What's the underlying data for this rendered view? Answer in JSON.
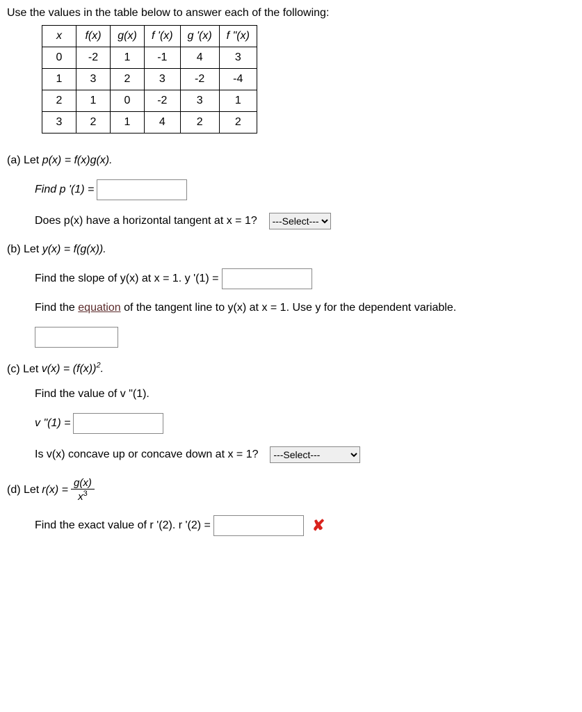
{
  "intro": "Use the values in the table below to answer each of the following:",
  "table": {
    "headers": [
      "x",
      "f(x)",
      "g(x)",
      "f '(x)",
      "g '(x)",
      "f \"(x)"
    ],
    "rows": [
      [
        "0",
        "-2",
        "1",
        "-1",
        "4",
        "3"
      ],
      [
        "1",
        "3",
        "2",
        "3",
        "-2",
        "-4"
      ],
      [
        "2",
        "1",
        "0",
        "-2",
        "3",
        "1"
      ],
      [
        "3",
        "2",
        "1",
        "4",
        "2",
        "2"
      ]
    ]
  },
  "partA": {
    "label": "(a) Let ",
    "def": "p(x) = f(x)g(x).",
    "find": "Find p '(1) = ",
    "tangent_q": "Does p(x) have a horizontal tangent at x = 1?",
    "select_placeholder": "---Select---"
  },
  "partB": {
    "label": "(b) Let ",
    "def": "y(x) = f(g(x)).",
    "slope": "Find the slope of y(x) at x = 1. y '(1) = ",
    "tangent_line_pre": "Find the ",
    "tangent_line_link": "equation",
    "tangent_line_post": " of the tangent line to y(x) at x = 1. Use y for the dependent variable."
  },
  "partC": {
    "label": "(c) Let ",
    "def_pre": "v(x) = (f(x))",
    "def_sup": "2",
    "def_post": ".",
    "find_val": "Find the value of v \"(1).",
    "v_eq": "v \"(1) = ",
    "concave_q": "Is v(x) concave up or concave down at x = 1?",
    "select_placeholder": "---Select---"
  },
  "partD": {
    "label": "(d) Let  ",
    "r_eq": "r(x) = ",
    "frac_num": "g(x)",
    "frac_den_base": "x",
    "frac_den_sup": "3",
    "find": "Find the exact value of r '(2). r '(2) = "
  },
  "chart_data": {
    "type": "table",
    "columns": [
      "x",
      "f(x)",
      "g(x)",
      "f '(x)",
      "g '(x)",
      "f \"(x)"
    ],
    "rows": [
      {
        "x": 0,
        "f(x)": -2,
        "g(x)": 1,
        "f '(x)": -1,
        "g '(x)": 4,
        "f \"(x)": 3
      },
      {
        "x": 1,
        "f(x)": 3,
        "g(x)": 2,
        "f '(x)": 3,
        "g '(x)": -2,
        "f \"(x)": -4
      },
      {
        "x": 2,
        "f(x)": 1,
        "g(x)": 0,
        "f '(x)": -2,
        "g '(x)": 3,
        "f \"(x)": 1
      },
      {
        "x": 3,
        "f(x)": 2,
        "g(x)": 1,
        "f '(x)": 4,
        "g '(x)": 2,
        "f \"(x)": 2
      }
    ]
  }
}
